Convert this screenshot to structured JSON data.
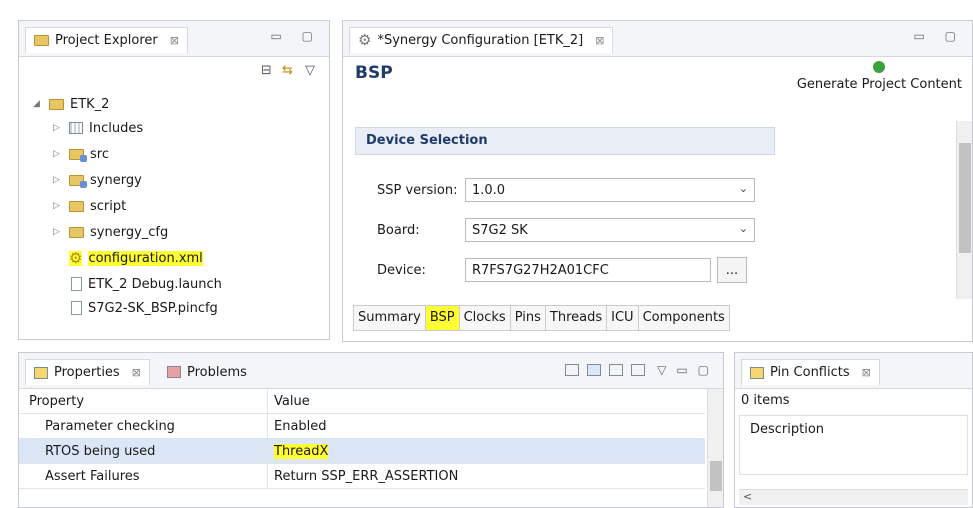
{
  "project_explorer": {
    "tab_label": "Project Explorer",
    "close_glyph": "⊠",
    "tree": [
      {
        "label": "ETK_2",
        "icon": "project-folder-icon",
        "level": 0,
        "expanded": true
      },
      {
        "label": "Includes",
        "icon": "includes-icon",
        "level": 1
      },
      {
        "label": "src",
        "icon": "source-folder-icon",
        "level": 1
      },
      {
        "label": "synergy",
        "icon": "source-folder-icon",
        "level": 1
      },
      {
        "label": "script",
        "icon": "folder-icon",
        "level": 1
      },
      {
        "label": "synergy_cfg",
        "icon": "folder-icon",
        "level": 1
      },
      {
        "label": "configuration.xml",
        "icon": "gear-icon",
        "level": 1,
        "highlighted": true
      },
      {
        "label": "ETK_2 Debug.launch",
        "icon": "file-icon",
        "level": 1
      },
      {
        "label": "S7G2-SK_BSP.pincfg",
        "icon": "file-icon",
        "level": 1
      }
    ]
  },
  "editor": {
    "tab_label": "*Synergy Configuration [ETK_2]",
    "page_title": "BSP",
    "generate_label": "Generate Project Content",
    "section_title": "Device Selection",
    "fields": [
      {
        "label": "SSP version:",
        "value": "1.0.0"
      },
      {
        "label": "Board:",
        "value": "S7G2 SK"
      },
      {
        "label": "Device:",
        "value": "R7FS7G27H2A01CFC"
      }
    ],
    "browse_label": "...",
    "tabs": [
      "Summary",
      "BSP",
      "Clocks",
      "Pins",
      "Threads",
      "ICU",
      "Components"
    ],
    "active_tab": "BSP"
  },
  "properties": {
    "tab_label": "Properties",
    "problems_label": "Problems",
    "columns": [
      "Property",
      "Value"
    ],
    "rows": [
      {
        "property": "Parameter checking",
        "value": "Enabled"
      },
      {
        "property": "RTOS being used",
        "value": "ThreadX",
        "highlighted": true
      },
      {
        "property": "Assert Failures",
        "value": "Return SSP_ERR_ASSERTION"
      }
    ]
  },
  "pin_conflicts": {
    "tab_label": "Pin Conflicts",
    "count_label": "0 items",
    "column": "Description"
  },
  "colors": {
    "highlight": "#ffff33",
    "section_title": "#1f3b6b",
    "generate_icon": "#3aa33a"
  }
}
